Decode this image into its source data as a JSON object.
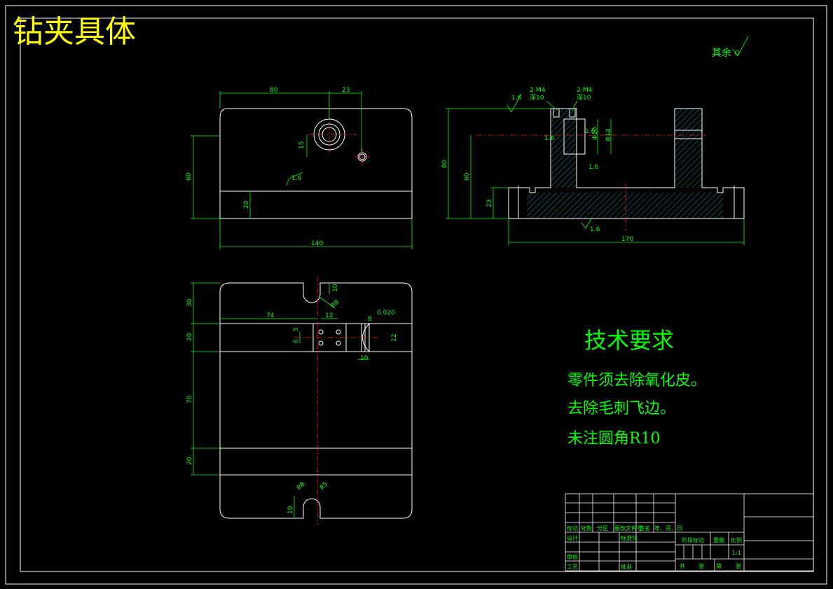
{
  "title": "钻夹具体",
  "roughness_note": "其余",
  "tech_requirements": {
    "heading": "技术要求",
    "items": [
      "零件须去除氧化皮。",
      "去除毛刺飞边。",
      "未注圆角R10"
    ]
  },
  "front_view": {
    "dims": {
      "d80": "80",
      "d23": "23",
      "d15": "15",
      "d60": "60",
      "d20": "20",
      "d140": "140",
      "rough": "1.6"
    }
  },
  "side_view": {
    "dims": {
      "m4a": "2-M4",
      "m4a_deep": "深10",
      "m4b": "2-M4",
      "m4b_deep": "深10",
      "r16a": "1.6",
      "r16b": "1.6",
      "r16c": "1.6",
      "r16d": "1.6",
      "r16e": "1.6",
      "d80": "80",
      "d60": "60",
      "d23": "23",
      "d170": "170",
      "phi": "Φ10",
      "phi14": "Φ14"
    }
  },
  "top_view": {
    "dims": {
      "d30": "30",
      "d20": "20",
      "d70": "70",
      "d20b": "20",
      "d74": "74",
      "d12": "12",
      "d10": "10",
      "d5": "5",
      "d6": "6",
      "d8": "8",
      "d10b": "10",
      "d12b": "12",
      "tol": "0.020",
      "r8": "R8",
      "r5": "R5"
    }
  },
  "title_block": {
    "header_row": [
      "标记",
      "处数",
      "分区",
      "更改文件号",
      "签名",
      "年、月、日"
    ],
    "design": "设计",
    "standardize": "标准化",
    "review": "审核",
    "process": "工艺",
    "approve": "批准",
    "stage_mark": "阶段标记",
    "weight": "重量",
    "scale": "比例",
    "scale_value": "1:1",
    "sheets_total": "共",
    "sheets_label": "张",
    "sheet_no": "第",
    "sheet_label": "张"
  }
}
